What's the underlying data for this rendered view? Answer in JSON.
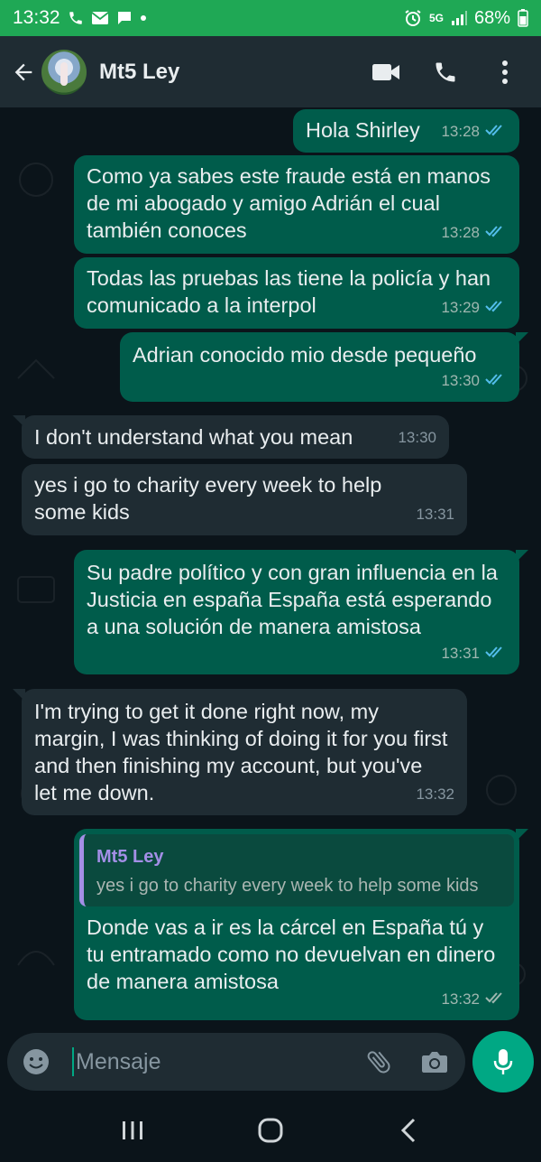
{
  "status_bar": {
    "time": "13:32",
    "network": "5G",
    "battery": "68%",
    "icons": [
      "phone-icon",
      "mail-icon",
      "chat-icon",
      "dot-icon",
      "alarm-icon",
      "signal-icon",
      "battery-icon"
    ]
  },
  "header": {
    "contact_name": "Mt5 Ley",
    "icons": [
      "back-arrow-icon",
      "video-call-icon",
      "voice-call-icon",
      "more-vert-icon"
    ]
  },
  "messages": [
    {
      "direction": "out",
      "text": "Hola Shirley",
      "time": "13:28",
      "status": "read"
    },
    {
      "direction": "out",
      "text": "Como ya sabes este fraude está en manos de mi abogado y amigo Adrián el cual también conoces",
      "time": "13:28",
      "status": "read"
    },
    {
      "direction": "out",
      "text": "Todas las pruebas las tiene la policía y han comunicado a la interpol",
      "time": "13:29",
      "status": "read"
    },
    {
      "direction": "out",
      "text": "Adrian conocido mio desde pequeño",
      "time": "13:30",
      "status": "read"
    },
    {
      "direction": "in",
      "text": "I don't understand what you mean",
      "time": "13:30"
    },
    {
      "direction": "in",
      "text": "yes i go to charity every week to help some kids",
      "time": "13:31"
    },
    {
      "direction": "out",
      "text": "Su padre político y con gran influencia en la Justicia en españa España está esperando a una solución de manera amistosa",
      "time": "13:31",
      "status": "read"
    },
    {
      "direction": "in",
      "text": "I'm trying to get it done right now, my margin, I was thinking of doing it for you first and then finishing my account, but you've let me down.",
      "time": "13:32"
    },
    {
      "direction": "out",
      "quote_author": "Mt5 Ley",
      "quote_text": "yes i go to charity every week to help some kids",
      "text": "Donde vas a ir es la cárcel en España tú y tu entramado como no devuelvan en dinero de manera amistosa",
      "time": "13:32",
      "status": "delivered"
    }
  ],
  "composer": {
    "placeholder": "Mensaje",
    "icons": [
      "emoji-icon",
      "attach-icon",
      "camera-icon",
      "mic-icon"
    ]
  },
  "colors": {
    "accent": "#00a884",
    "status_bar": "#1fa855",
    "header": "#1f2c33",
    "outgoing_bubble": "#005c4b",
    "incoming_bubble": "#1f2c33",
    "read_tick": "#53bdeb",
    "quote_author": "#a38fe6"
  }
}
